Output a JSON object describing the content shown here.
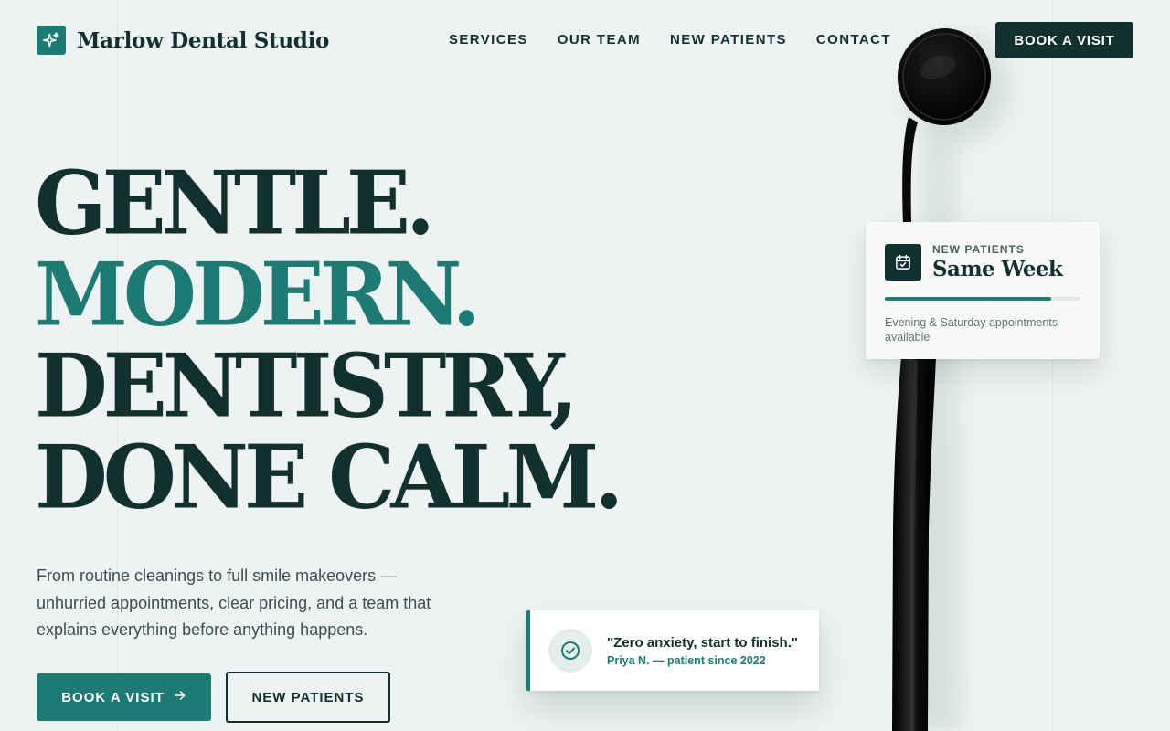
{
  "brand": {
    "name": "Marlow Dental Studio",
    "logo_icon": "sparkle-icon"
  },
  "nav": {
    "items": [
      {
        "label": "SERVICES"
      },
      {
        "label": "OUR TEAM"
      },
      {
        "label": "NEW PATIENTS"
      },
      {
        "label": "CONTACT"
      }
    ],
    "cta": "BOOK A VISIT"
  },
  "hero": {
    "headline": [
      "GENTLE.",
      "MODERN.",
      "DENTISTRY,",
      "DONE CALM."
    ],
    "intro": "From routine cleanings to full smile makeovers — unhurried appointments, clear pricing, and a team that explains everything before anything happens.",
    "primary_button": "BOOK A VISIT",
    "secondary_button": "NEW PATIENTS"
  },
  "availability_card": {
    "eyebrow": "NEW PATIENTS",
    "title": "Same Week",
    "progress": 0.85,
    "note": "Evening & Saturday appointments available",
    "icon": "calendar-check-icon"
  },
  "testimonial": {
    "quote": "\"Zero anxiety, start to finish.\"",
    "author": "Priya N. — patient since 2022",
    "icon": "check-circle-icon"
  },
  "colors": {
    "background": "#edf3f2",
    "dark": "#12302e",
    "accent": "#1e7b74",
    "white": "#ffffff"
  }
}
